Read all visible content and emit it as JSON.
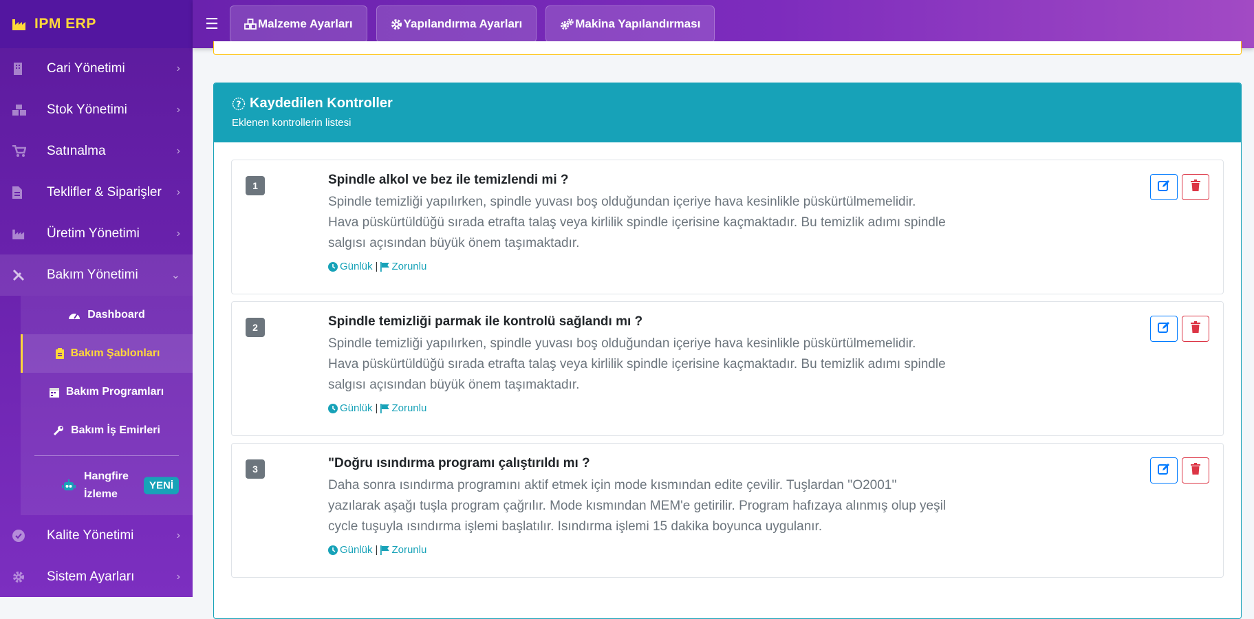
{
  "brand": {
    "name": "IPM ERP"
  },
  "sidebar": {
    "items": [
      {
        "label": "Cari Yönetimi",
        "icon": "building-icon"
      },
      {
        "label": "Stok Yönetimi",
        "icon": "boxes-icon"
      },
      {
        "label": "Satınalma",
        "icon": "cart-icon"
      },
      {
        "label": "Teklifler & Siparişler",
        "icon": "invoice-icon"
      },
      {
        "label": "Üretim Yönetimi",
        "icon": "industry-icon"
      },
      {
        "label": "Bakım Yönetimi",
        "icon": "tools-icon",
        "open": true
      },
      {
        "label": "Kalite Yönetimi",
        "icon": "check-circle-icon"
      },
      {
        "label": "Sistem Ayarları",
        "icon": "cog-icon"
      }
    ],
    "submenu": [
      {
        "label": "Dashboard",
        "icon": "gauge-icon"
      },
      {
        "label": "Bakım Şablonları",
        "icon": "clipboard-icon",
        "active": true
      },
      {
        "label": "Bakım Programları",
        "icon": "calendar-icon"
      },
      {
        "label": "Bakım İş Emirleri",
        "icon": "wrench-icon"
      }
    ],
    "hangfire": {
      "label": "Hangfire İzleme",
      "badge": "YENİ",
      "icon": "robot-icon"
    }
  },
  "topbar": {
    "buttons": [
      {
        "label": "Malzeme Ayarları",
        "icon": "cubes-icon"
      },
      {
        "label": "Yapılandırma Ayarları",
        "icon": "gear-icon"
      },
      {
        "label": "Makina Yapılandırması",
        "icon": "gears-icon"
      }
    ]
  },
  "card": {
    "title": "Kaydedilen Kontroller",
    "subtitle": "Eklenen kontrollerin listesi",
    "controls": [
      {
        "number": "1",
        "title": "Spindle alkol ve bez ile temizlendi mi ?",
        "description": "Spindle temizliği yapılırken, spindle yuvası boş olduğundan içeriye hava kesinlikle püskürtülmemelidir. Hava püskürtüldüğü sırada etrafta talaş veya kirlilik spindle içerisine kaçmaktadır. Bu temizlik adımı spindle salgısı açısından büyük önem taşımaktadır.",
        "frequency": "Günlük",
        "requirement": "Zorunlu"
      },
      {
        "number": "2",
        "title": "Spindle temizliği parmak ile kontrolü sağlandı mı ?",
        "description": "Spindle temizliği yapılırken, spindle yuvası boş olduğundan içeriye hava kesinlikle püskürtülmemelidir. Hava püskürtüldüğü sırada etrafta talaş veya kirlilik spindle içerisine kaçmaktadır. Bu temizlik adımı spindle salgısı açısından büyük önem taşımaktadır.",
        "frequency": "Günlük",
        "requirement": "Zorunlu"
      },
      {
        "number": "3",
        "title": "\"Doğru ısındırma programı çalıştırıldı mı ?",
        "description": "Daha sonra ısındırma programını aktif etmek için mode kısmından edite çevilir. Tuşlardan ''O2001'' yazılarak aşağı tuşla program çağrılır. Mode kısmından MEM'e getirilir. Program hafızaya alınmış olup yeşil cycle tuşuyla ısındırma işlemi başlatılır. Isındırma işlemi 15 dakika boyunca uygulanır.",
        "frequency": "Günlük",
        "requirement": "Zorunlu"
      }
    ]
  },
  "colors": {
    "sidebar": "#6a22ad",
    "brand": "#ffd83a",
    "card_header": "#17a2b8",
    "edit": "#007bff",
    "delete": "#dc3545"
  }
}
